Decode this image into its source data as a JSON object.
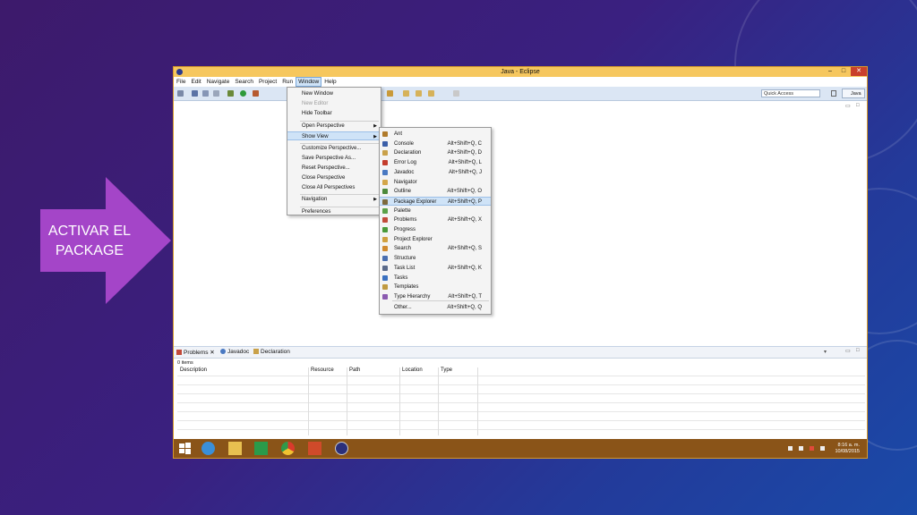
{
  "slide": {
    "callout": {
      "line1": "ACTIVAR EL",
      "line2": "PACKAGE"
    }
  },
  "window": {
    "title": "Java - Eclipse",
    "menubar": [
      "File",
      "Edit",
      "Navigate",
      "Search",
      "Project",
      "Run",
      "Window",
      "Help"
    ],
    "active_menu": "Window",
    "quick_access": "Quick Access",
    "perspective": "Java"
  },
  "window_menu": {
    "items": [
      {
        "label": "New Window"
      },
      {
        "label": "New Editor",
        "disabled": true
      },
      {
        "label": "Hide Toolbar"
      },
      {
        "label": "Open Perspective",
        "submenu": true
      },
      {
        "label": "Show View",
        "submenu": true,
        "highlighted": true
      },
      {
        "label": "Customize Perspective..."
      },
      {
        "label": "Save Perspective As..."
      },
      {
        "label": "Reset Perspective..."
      },
      {
        "label": "Close Perspective"
      },
      {
        "label": "Close All Perspectives"
      },
      {
        "label": "Navigation",
        "submenu": true
      },
      {
        "label": "Preferences"
      }
    ]
  },
  "show_view_menu": {
    "items": [
      {
        "label": "Ant",
        "shortcut": "",
        "icon_color": "#b07a2a"
      },
      {
        "label": "Console",
        "shortcut": "Alt+Shift+Q, C",
        "icon_color": "#3b5fa8"
      },
      {
        "label": "Declaration",
        "shortcut": "Alt+Shift+Q, D",
        "icon_color": "#c9a14a"
      },
      {
        "label": "Error Log",
        "shortcut": "Alt+Shift+Q, L",
        "icon_color": "#c33c2c"
      },
      {
        "label": "Javadoc",
        "shortcut": "Alt+Shift+Q, J",
        "icon_color": "#4a79c2"
      },
      {
        "label": "Navigator",
        "shortcut": "",
        "icon_color": "#d3a64a"
      },
      {
        "label": "Outline",
        "shortcut": "Alt+Shift+Q, O",
        "icon_color": "#4d8a3c"
      },
      {
        "label": "Package Explorer",
        "shortcut": "Alt+Shift+Q, P",
        "icon_color": "#7d6a3d",
        "highlighted": true
      },
      {
        "label": "Palette",
        "shortcut": "",
        "icon_color": "#5aa148"
      },
      {
        "label": "Problems",
        "shortcut": "Alt+Shift+Q, X",
        "icon_color": "#c24a3a"
      },
      {
        "label": "Progress",
        "shortcut": "",
        "icon_color": "#4a9a3a"
      },
      {
        "label": "Project Explorer",
        "shortcut": "",
        "icon_color": "#d0a040"
      },
      {
        "label": "Search",
        "shortcut": "Alt+Shift+Q, S",
        "icon_color": "#d08a30"
      },
      {
        "label": "Structure",
        "shortcut": "",
        "icon_color": "#4a6fb0"
      },
      {
        "label": "Task List",
        "shortcut": "Alt+Shift+Q, K",
        "icon_color": "#5a6a8a"
      },
      {
        "label": "Tasks",
        "shortcut": "",
        "icon_color": "#3a70c0"
      },
      {
        "label": "Templates",
        "shortcut": "",
        "icon_color": "#c09a40"
      },
      {
        "label": "Type Hierarchy",
        "shortcut": "Alt+Shift+Q, T",
        "icon_color": "#8a5ab0"
      },
      {
        "label": "Other...",
        "shortcut": "Alt+Shift+Q, Q",
        "icon_color": ""
      }
    ]
  },
  "bottom_pane": {
    "tabs": [
      {
        "label": "Problems",
        "active": true
      },
      {
        "label": "Javadoc"
      },
      {
        "label": "Declaration"
      }
    ],
    "items_count": "0 items",
    "columns": [
      "Description",
      "Resource",
      "Path",
      "Location",
      "Type"
    ]
  },
  "taskbar": {
    "time": "8:16 a. m.",
    "date": "10/08/2015"
  }
}
